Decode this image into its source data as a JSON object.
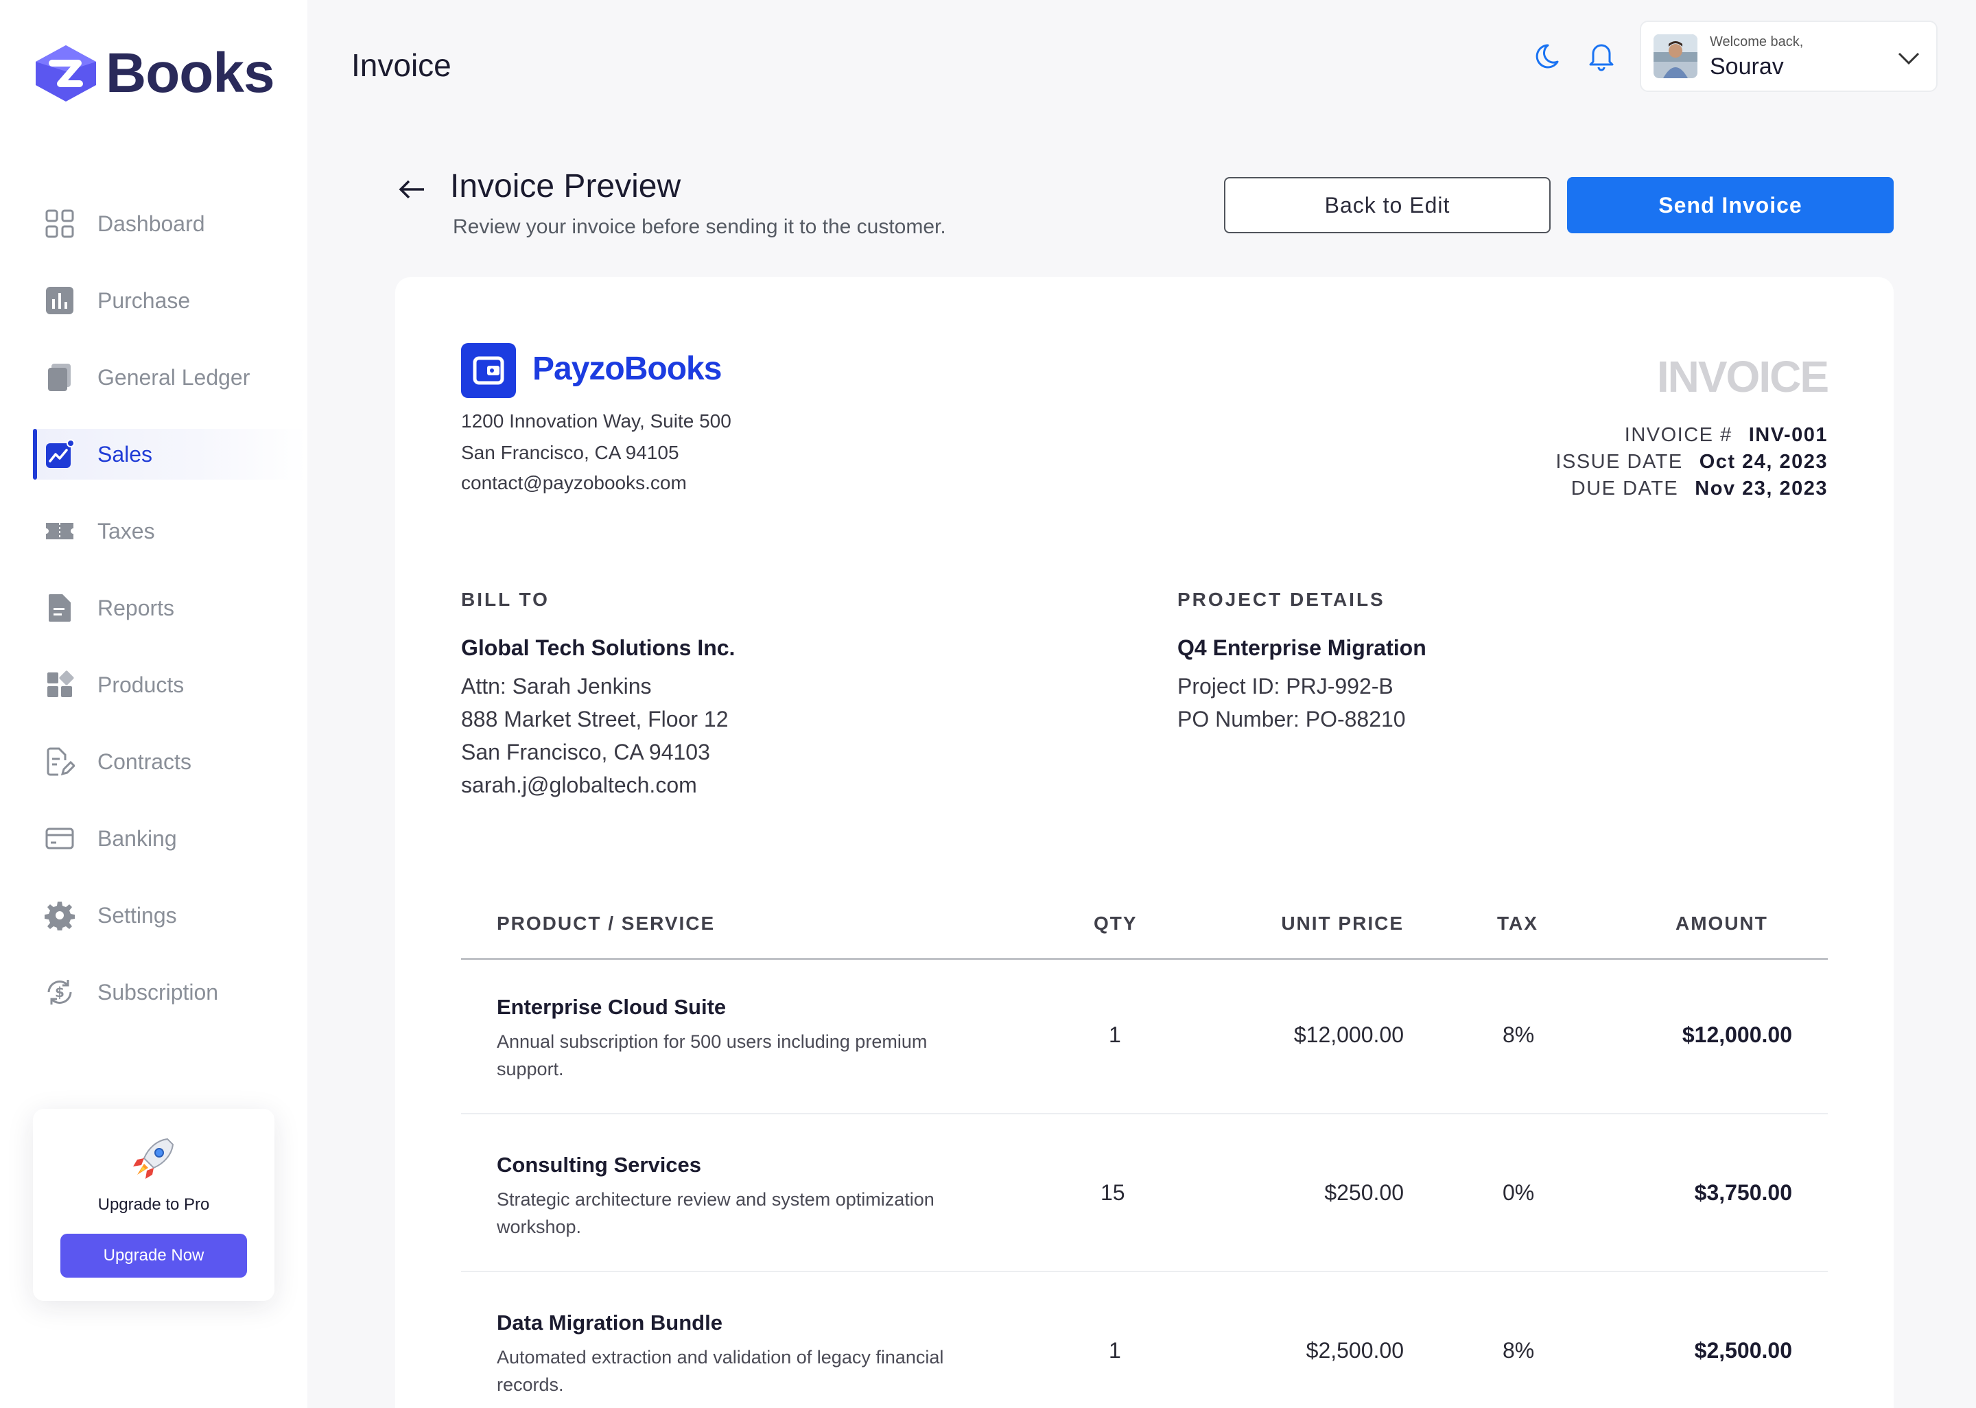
{
  "app": {
    "brand": "Books"
  },
  "header": {
    "title": "Invoice",
    "welcome": "Welcome back,",
    "user_name": "Sourav"
  },
  "sidebar": {
    "items": [
      {
        "label": "Dashboard",
        "icon": "grid-icon"
      },
      {
        "label": "Purchase",
        "icon": "bar-chart-icon"
      },
      {
        "label": "General Ledger",
        "icon": "ledger-icon"
      },
      {
        "label": "Sales",
        "icon": "sales-trend-icon",
        "active": true
      },
      {
        "label": "Taxes",
        "icon": "ticket-icon"
      },
      {
        "label": "Reports",
        "icon": "report-icon"
      },
      {
        "label": "Products",
        "icon": "products-icon"
      },
      {
        "label": "Contracts",
        "icon": "contract-icon"
      },
      {
        "label": "Banking",
        "icon": "card-icon"
      },
      {
        "label": "Settings",
        "icon": "gear-icon"
      },
      {
        "label": "Subscription",
        "icon": "subscription-icon"
      }
    ],
    "upgrade": {
      "title": "Upgrade to Pro",
      "button": "Upgrade Now"
    }
  },
  "preview": {
    "title": "Invoice Preview",
    "subtitle": "Review your invoice before sending it to the customer.",
    "back_to_edit": "Back to Edit",
    "send_invoice": "Send Invoice"
  },
  "invoice": {
    "company": {
      "name": "PayzoBooks",
      "address_line1": "1200 Innovation Way, Suite 500",
      "address_line2": "San Francisco, CA 94105",
      "email": "contact@payzobooks.com"
    },
    "doc_label": "INVOICE",
    "meta": {
      "number_label": "INVOICE #",
      "number": "INV-001",
      "issue_label": "ISSUE DATE",
      "issue": "Oct 24, 2023",
      "due_label": "DUE DATE",
      "due": "Nov 23, 2023"
    },
    "bill_to": {
      "label": "BILL TO",
      "company": "Global Tech Solutions Inc.",
      "attn": "Attn: Sarah Jenkins",
      "street": "888 Market Street, Floor 12",
      "city": "San Francisco, CA 94103",
      "email": "sarah.j@globaltech.com"
    },
    "project": {
      "label": "PROJECT DETAILS",
      "name": "Q4 Enterprise Migration",
      "project_id": "Project ID: PRJ-992-B",
      "po_number": "PO Number: PO-88210"
    },
    "table": {
      "headers": {
        "product": "PRODUCT / SERVICE",
        "qty": "QTY",
        "unit_price": "UNIT PRICE",
        "tax": "TAX",
        "amount": "AMOUNT"
      },
      "rows": [
        {
          "title": "Enterprise Cloud Suite",
          "desc": "Annual subscription for 500 users including premium support.",
          "qty": "1",
          "unit_price": "$12,000.00",
          "tax": "8%",
          "amount": "$12,000.00"
        },
        {
          "title": "Consulting Services",
          "desc": "Strategic architecture review and system optimization workshop.",
          "qty": "15",
          "unit_price": "$250.00",
          "tax": "0%",
          "amount": "$3,750.00"
        },
        {
          "title": "Data Migration Bundle",
          "desc": "Automated extraction and validation of legacy financial records.",
          "qty": "1",
          "unit_price": "$2,500.00",
          "tax": "8%",
          "amount": "$2,500.00"
        }
      ]
    }
  },
  "colors": {
    "accent": "#1a73f2",
    "brand_blue": "#1c3ce0",
    "upgrade": "#5b57f0",
    "active_nav": "#1f3bd6"
  }
}
